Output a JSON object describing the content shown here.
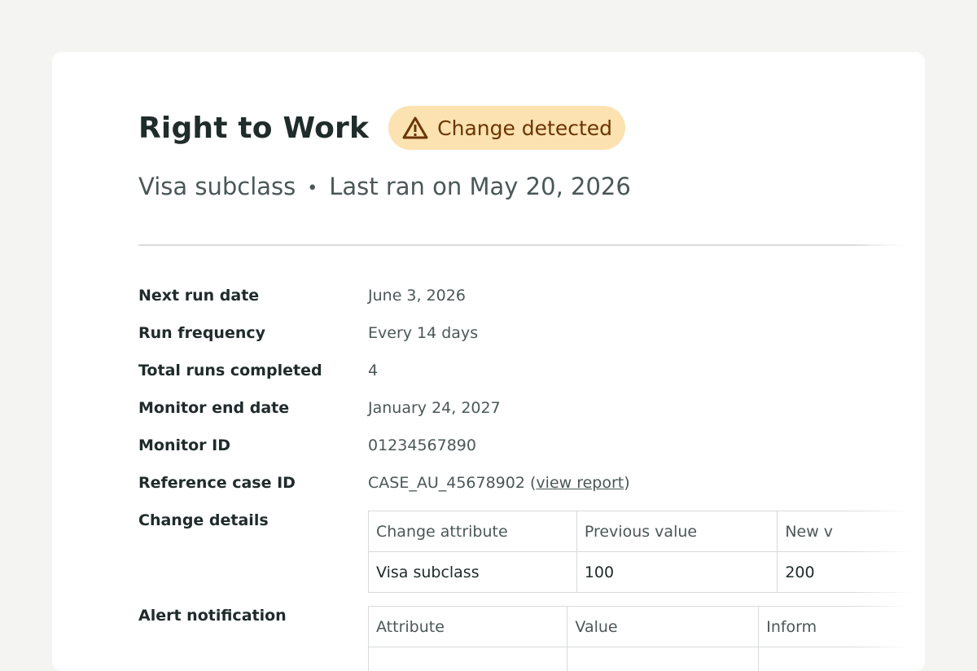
{
  "header": {
    "title": "Right to Work",
    "badge": "Change detected",
    "subtitle_left": "Visa subclass",
    "subtitle_sep": "•",
    "subtitle_right": "Last ran on May 20, 2026"
  },
  "details": {
    "next_run_label": "Next run date",
    "next_run_value": "June 3, 2026",
    "frequency_label": "Run frequency",
    "frequency_value": "Every 14 days",
    "total_runs_label": "Total runs completed",
    "total_runs_value": "4",
    "end_date_label": "Monitor end date",
    "end_date_value": "January 24, 2027",
    "monitor_id_label": "Monitor ID",
    "monitor_id_value": "01234567890",
    "reference_label": "Reference case ID",
    "reference_value": "CASE_AU_45678902",
    "reference_open": "(",
    "reference_link": "view report",
    "reference_close": ")"
  },
  "change_details": {
    "label": "Change details",
    "headers": [
      "Change attribute",
      "Previous value",
      "New v"
    ],
    "row": [
      "Visa subclass",
      "100",
      "200"
    ]
  },
  "alert_notification": {
    "label": "Alert notification",
    "headers": [
      "Attribute",
      "Value",
      "Inform"
    ]
  },
  "colors": {
    "badge_bg": "#fde2b1",
    "badge_text": "#6b3503",
    "page_bg": "#f4f5f3"
  },
  "icons": {
    "badge_icon": "warning-triangle-icon"
  }
}
